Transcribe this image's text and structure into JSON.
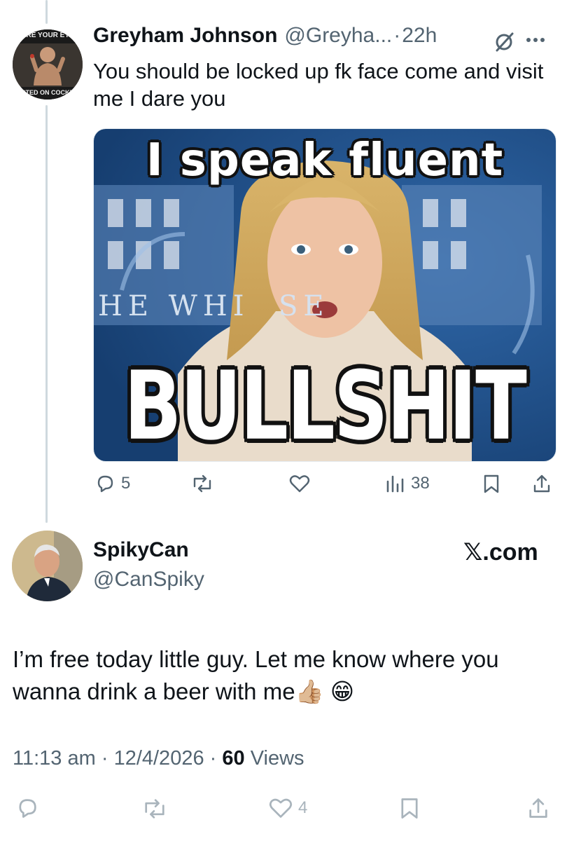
{
  "reply_tweet": {
    "display_name": "Greyham Johnson",
    "handle_truncated": "@Greyha...",
    "separator": "·",
    "time_ago": "22h",
    "text": "You should be locked up fk face come and visit me I dare you",
    "avatar_text_top": "ARE YOUR EYE",
    "avatar_text_bottom": "RTED ON COCKN",
    "media": {
      "top_caption": "I speak fluent",
      "bottom_caption": "BULLSHIT",
      "background_text": "HE WHI  SE"
    },
    "actions": {
      "replies": "5",
      "views": "38"
    }
  },
  "main_tweet": {
    "display_name": "SpikyCan",
    "handle": "@CanSpiky",
    "brand": "𝕏.com",
    "text": "I’m free today little guy. Let me know where you wanna drink a beer with me👍🏼 😁",
    "time": "11:13 am",
    "separator": "·",
    "date": "12/4/2026",
    "views_count": "60",
    "views_label": " Views",
    "actions": {
      "likes": "4"
    }
  },
  "colors": {
    "text": "#0f1419",
    "muted": "#536471",
    "thread_line": "#cfd9de"
  }
}
